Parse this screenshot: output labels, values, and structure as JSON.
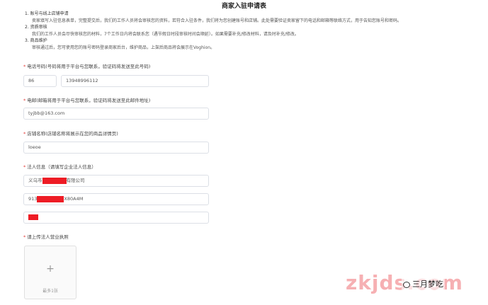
{
  "page": {
    "title": "商家入驻申请表"
  },
  "intro": {
    "steps": [
      {
        "title": "1. 账号与线上店铺申请",
        "desc": "卖家填写入驻信息表单，完整提交后，我们的工作人员将会审核您的资料，若符合入驻条件，我们将为您创建账号和店铺。此处需要验证卖家留下的电话和邮箱等联络方式，用于告知您账号和密码。"
      },
      {
        "title": "2. 资质审核",
        "desc": "我们的工作人员会尽快审核您的材料，7个工作日内将会联系您（遇节假日时段审核时间会顺延）。如果需要补充/修改材料，请及时补充/修改。"
      },
      {
        "title": "3. 商品维护",
        "desc": "审核通过后，您可使用您的账号密码登录商家后台，维护商品，上架后商品将会展示在Voghion。"
      }
    ]
  },
  "form": {
    "phone": {
      "label": "电话号码(号码将用于平台与您联系，验证码将发送至此号码)",
      "country_code": "86",
      "number": "13948996112"
    },
    "email": {
      "label": "电邮(邮箱将用于平台与您联系，验证码将发送至此邮件地址)",
      "value": "tyjbb@163.com"
    },
    "shop_name": {
      "label": "店铺名称(店铺名称将展示在您的商品详情页)",
      "value": "loeoe"
    },
    "legal": {
      "label": "法人信息（请填写企业法人信息）",
      "company_prefix": "义乌市",
      "company_suffix": "有限公司",
      "credit_code_prefix": "913",
      "credit_code_suffix": "X80A4M"
    },
    "license": {
      "label": "请上传法人营业执照",
      "plus": "+",
      "hint": "最多1张"
    }
  },
  "watermark": {
    "site": "zkjds.com",
    "author": "三月梦吃"
  },
  "colors": {
    "required": "#e53935",
    "redaction": "#ee1c25",
    "border": "#dcdfe6",
    "watermark": "#f5a3a6"
  }
}
